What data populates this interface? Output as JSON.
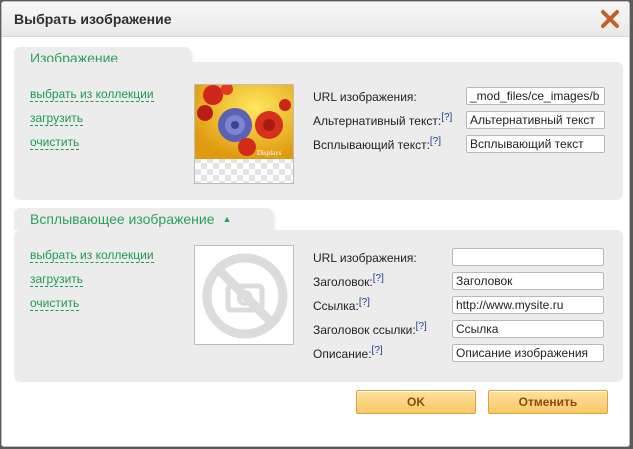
{
  "dialog": {
    "title": "Выбрать изображение"
  },
  "image_section": {
    "tab_label": "Изображение",
    "links": {
      "choose": "выбрать из коллекции",
      "upload": "загрузить",
      "clear": "очистить"
    },
    "fields": {
      "url_label": "URL изображения:",
      "url_value": "_mod_files/ce_images/b",
      "alt_label": "Альтернативный текст:",
      "alt_value": "Альтернативный текст",
      "tooltip_label": "Всплывающий текст:",
      "tooltip_value": "Всплывающий текст"
    },
    "help_mark": "[?]"
  },
  "popup_section": {
    "tab_label": "Всплывающее изображение",
    "links": {
      "choose": "выбрать из коллекции",
      "upload": "загрузить",
      "clear": "очистить"
    },
    "fields": {
      "url_label": "URL изображения:",
      "url_value": "",
      "heading_label": "Заголовок:",
      "heading_value": "Заголовок",
      "link_label": "Ссылка:",
      "link_value": "http://www.mysite.ru",
      "link_title_label": "Заголовок ссылки:",
      "link_title_value": "Ссылка",
      "description_label": "Описание:",
      "description_value": "Описание изображения"
    },
    "help_mark": "[?]"
  },
  "buttons": {
    "ok": "OK",
    "cancel": "Отменить"
  },
  "thumbnail_text": "Displays",
  "colors": {
    "accent_green": "#2aa15a",
    "button_orange": "#f9c766",
    "close_icon": "#c0612a"
  }
}
